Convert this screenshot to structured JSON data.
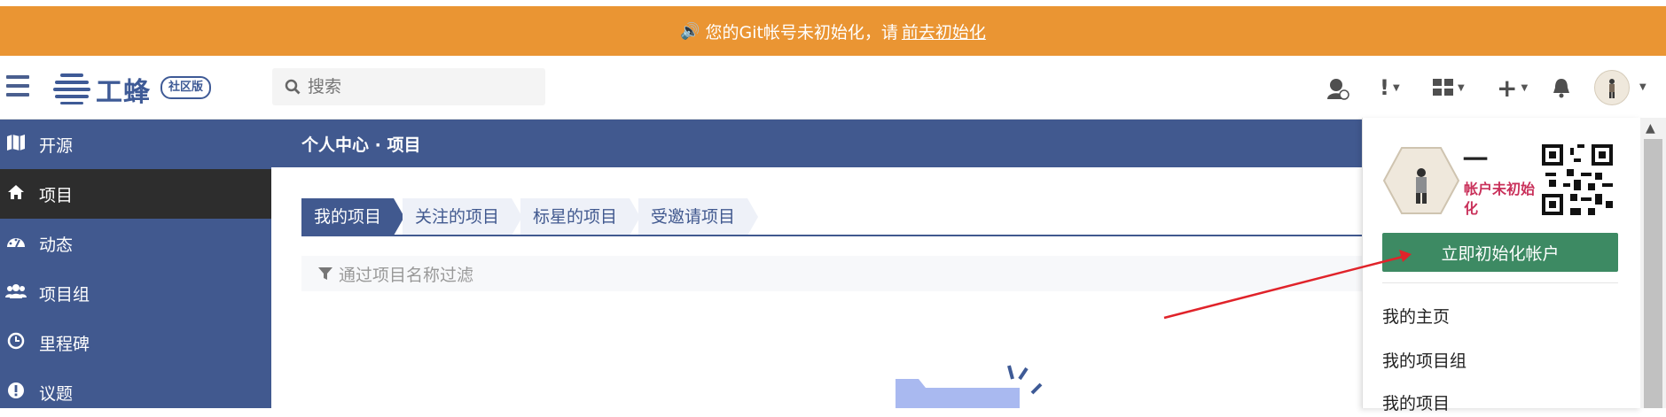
{
  "banner": {
    "text": "您的Git帐号未初始化，请",
    "link": "前去初始化",
    "icon": "speaker-icon",
    "color": "#ea9533"
  },
  "header": {
    "logo_text": "工蜂",
    "logo_badge": "社区版",
    "search_placeholder": "搜索",
    "icons": [
      "support-icon",
      "alert-icon",
      "apps-grid-icon",
      "plus-icon",
      "bell-icon",
      "avatar"
    ]
  },
  "sidebar": {
    "color": "#41598f",
    "items": [
      {
        "label": "开源",
        "icon": "map-icon"
      },
      {
        "label": "项目",
        "icon": "home-icon",
        "active": true
      },
      {
        "label": "动态",
        "icon": "dashboard-icon"
      },
      {
        "label": "项目组",
        "icon": "users-icon"
      },
      {
        "label": "里程碑",
        "icon": "clock-icon"
      },
      {
        "label": "议题",
        "icon": "exclamation-icon"
      }
    ]
  },
  "main": {
    "breadcrumb": "个人中心 · 项目",
    "tabs": [
      {
        "label": "我的项目",
        "active": true
      },
      {
        "label": "关注的项目"
      },
      {
        "label": "标星的项目"
      },
      {
        "label": "受邀请项目"
      }
    ],
    "filter_placeholder": "通过项目名称过滤"
  },
  "dropdown": {
    "name": "一",
    "status": "帐户未初始化",
    "init_button": "立即初始化帐户",
    "links": [
      "我的主页",
      "我的项目组",
      "我的项目"
    ]
  }
}
